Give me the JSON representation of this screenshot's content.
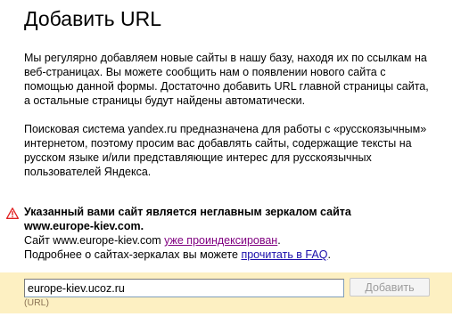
{
  "page": {
    "title": "Добавить URL"
  },
  "intro": {
    "lines": [
      "Мы регулярно добавляем новые сайты в нашу базу, находя их по ссылкам на",
      "веб-страницах. Вы можете сообщить нам о появлении нового сайта с",
      "помощью данной формы. Достаточно добавить URL главной страницы сайта,",
      "а остальные страницы будут найдены автоматически."
    ]
  },
  "notice": {
    "lines": [
      "Поисковая система yandex.ru предназначена для работы с «русскоязычным»",
      "интернетом, поэтому просим вас добавлять сайты, содержащие тексты на",
      "русском языке и/или представляющие интерес для русскоязычных",
      "пользователей Яндекса."
    ]
  },
  "warning": {
    "headline_line1": "Указанный вами сайт является неглавным зеркалом сайта",
    "headline_line2": "www.europe-kiev.com.",
    "site_prefix": "Сайт www.europe-kiev.com ",
    "indexed_link": "уже проиндексирован",
    "site_suffix": ".",
    "faq_prefix": "Подробнее о сайтах-зеркалах вы можете ",
    "faq_link": "прочитать в FAQ",
    "faq_suffix": "."
  },
  "form": {
    "url_value": "europe-kiev.ucoz.ru",
    "submit_label": "Добавить",
    "field_hint": "(URL)"
  },
  "colors": {
    "form_band": "#fdf0c2",
    "link": "#1a0dab",
    "visited_link": "#800080",
    "warning_icon": "#e02020"
  }
}
